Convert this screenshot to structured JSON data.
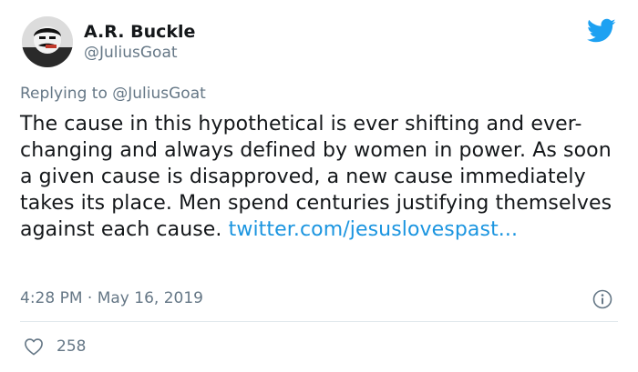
{
  "author": {
    "display_name": "A.R. Buckle",
    "handle": "@JuliusGoat"
  },
  "reply": {
    "prefix": "Replying to ",
    "mention": "@JuliusGoat"
  },
  "tweet": {
    "text": "The cause in this hypothetical is ever shifting and ever-changing and always defined by women in power. As soon a given cause is disapproved, a new cause immediately takes its place. Men spend centuries justifying themselves against each cause. ",
    "link": "twitter.com/jesuslovespast..."
  },
  "meta": {
    "time": "4:28 PM",
    "separator": " · ",
    "date": "May 16, 2019"
  },
  "actions": {
    "like_count": "258"
  },
  "icons": {
    "logo": "twitter-bird-icon",
    "info": "info-icon",
    "like": "heart-icon"
  },
  "colors": {
    "brand": "#1da1f2",
    "link": "#1b95e0",
    "secondary_text": "#657786",
    "divider": "#e1e8ed"
  }
}
